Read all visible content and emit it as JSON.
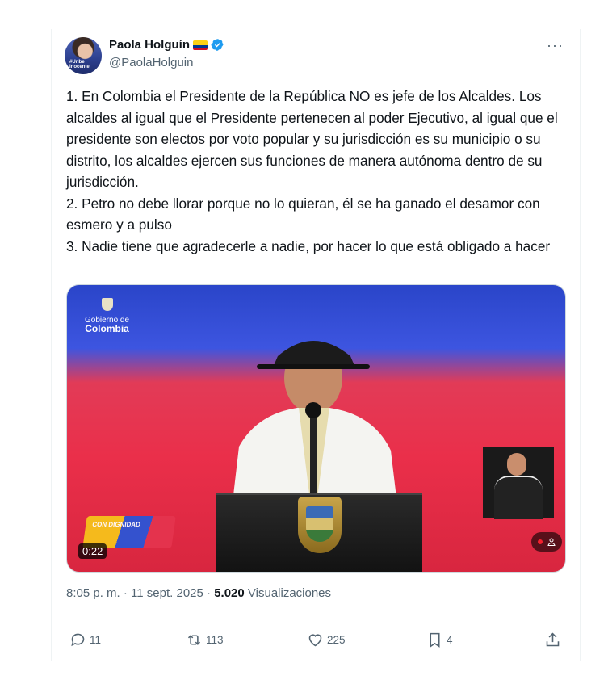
{
  "author": {
    "display_name": "Paola Holguín",
    "handle": "@PaolaHolguin",
    "avatar_text": "#Uribe Inocente",
    "flag_icon": "colombia-flag-icon",
    "verified_icon": "verified-badge-icon",
    "verified_color": "#1d9bf0"
  },
  "menu_icon": "more-options-icon",
  "tweet": {
    "paragraphs": [
      "1. En Colombia el Presidente de la República NO es jefe de los Alcaldes. Los alcaldes al igual que el Presidente pertenecen al poder Ejecutivo, al igual que el presidente son electos por voto popular y su jurisdicción es su municipio o su distrito, los alcaldes ejercen sus funciones de manera autónoma dentro de su jurisdicción.",
      "2. Petro no debe llorar porque no lo quieran, él se ha ganado el desamor con esmero y a pulso",
      "3. Nadie tiene que agradecerle a nadie, por hacer lo que está obligado a hacer"
    ]
  },
  "media": {
    "overlay_gov_line1": "Gobierno de",
    "overlay_gov_line2": "Colombia",
    "overlay_logo_text": "CON DIGNIDAD",
    "duration": "0:22",
    "live_icon": "person-icon"
  },
  "meta": {
    "time": "8:05 p. m.",
    "separator": "·",
    "date": "11 sept. 2025",
    "views_count": "5.020",
    "views_label": "Visualizaciones"
  },
  "actions": {
    "replies": "11",
    "reposts": "113",
    "likes": "225",
    "bookmarks": "4"
  },
  "colors": {
    "text": "#0f1419",
    "secondary": "#536471",
    "border": "#eff3f4"
  }
}
